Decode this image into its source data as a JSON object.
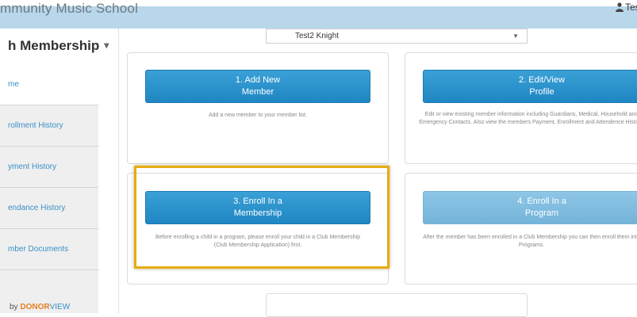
{
  "header": {
    "app_title": "mmunity Music School",
    "user_label": "Tes"
  },
  "sidebar": {
    "title": "h Membership",
    "items": [
      {
        "label": "me"
      },
      {
        "label": "rollment History"
      },
      {
        "label": "yment History"
      },
      {
        "label": "endance History"
      },
      {
        "label": "mber Documents"
      }
    ],
    "powered_prefix": "by ",
    "powered_brand_a": "DONOR",
    "powered_brand_b": "VIEW"
  },
  "member_select": {
    "selected": "Test2 Knight"
  },
  "cards": [
    {
      "line1": "1. Add New",
      "line2": "Member",
      "description": "Add a new member to your member list."
    },
    {
      "line1": "2. Edit/View",
      "line2": "Profile",
      "description": "Edit or view existing member information including Guardians, Medical, Household and Emergency Contacts. Also view the members Payment, Enrollment and Attendence History."
    },
    {
      "line1": "3. Enroll In a",
      "line2": "Membership",
      "description": "Before enrolling a child in a program, please enroll your child in a Club Membership (Club Membership Application) first."
    },
    {
      "line1": "4. Enroll In a",
      "line2": "Program",
      "description": "After the member has been enrolled in a Club Membership you can then enroll them into Programs."
    }
  ],
  "colors": {
    "accent": "#2a93cf",
    "highlight": "#e5ad12",
    "header_strip": "#b9d7ea"
  }
}
